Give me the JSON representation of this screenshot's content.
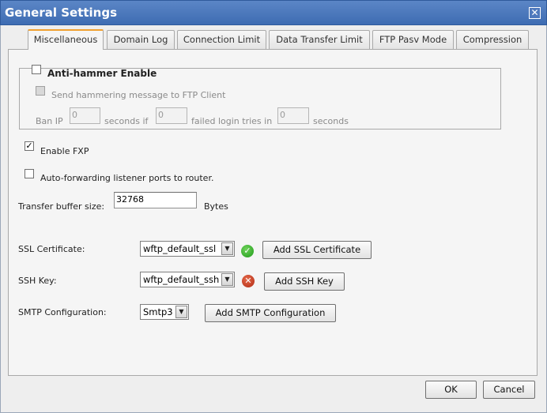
{
  "window": {
    "title": "General Settings",
    "close_glyph": "✕"
  },
  "tabs": [
    {
      "label": "Miscellaneous",
      "active": true
    },
    {
      "label": "Domain Log",
      "active": false
    },
    {
      "label": "Connection Limit",
      "active": false
    },
    {
      "label": "Data Transfer Limit",
      "active": false
    },
    {
      "label": "FTP Pasv Mode",
      "active": false
    },
    {
      "label": "Compression",
      "active": false
    }
  ],
  "anti_hammer": {
    "enable_label": "Anti-hammer Enable",
    "enable_checked": false,
    "send_message_label": "Send hammering message to FTP Client",
    "ban_ip_label": "Ban IP",
    "ban_ip_value": "0",
    "seconds_if_label": "seconds if",
    "failed_tries_value": "0",
    "failed_tries_label": "failed login tries in",
    "period_value": "0",
    "seconds_label": "seconds"
  },
  "fxp": {
    "label": "Enable FXP",
    "checked": true,
    "check_glyph": "✓"
  },
  "auto_forward": {
    "label": "Auto-forwarding listener ports to router.",
    "checked": false
  },
  "buffer": {
    "label": "Transfer buffer size:",
    "value": "32768",
    "unit": "Bytes"
  },
  "ssl": {
    "label": "SSL Certificate:",
    "selected": "wftp_default_ssl",
    "status": "valid",
    "status_glyph": "✓",
    "button": "Add SSL Certificate"
  },
  "ssh": {
    "label": "SSH Key:",
    "selected": "wftp_default_ssh",
    "status": "invalid",
    "status_glyph": "✕",
    "button": "Add SSH Key"
  },
  "smtp": {
    "label": "SMTP Configuration:",
    "selected": "Smtp3",
    "button": "Add SMTP Configuration"
  },
  "dropdown_glyph": "▼",
  "footer": {
    "ok": "OK",
    "cancel": "Cancel"
  },
  "colors": {
    "titlebar": "#3e6cb2",
    "active_tab_accent": "#f0a030",
    "ok_status": "#1f9a1a",
    "error_status": "#b02a14"
  }
}
